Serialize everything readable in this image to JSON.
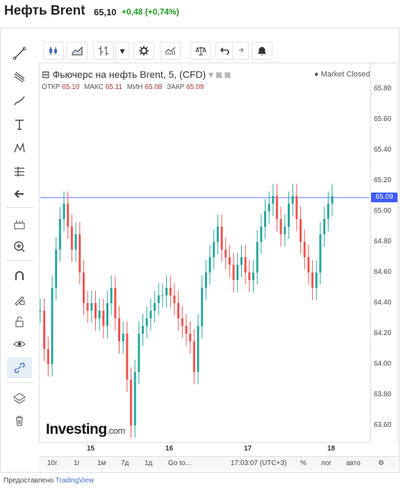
{
  "header": {
    "title": "Нефть Brent",
    "price": "65,10",
    "change": "+0,48 (+0,74%)"
  },
  "toolbar": {
    "more_label": "▾"
  },
  "legend": {
    "symbol": "Фьючерс на нефть Brent, 5, (CFD)",
    "market_status": "Market Closed",
    "ohlc": [
      {
        "k": "ОТКР",
        "v": "65.10"
      },
      {
        "k": "МАКС",
        "v": "65.11"
      },
      {
        "k": "МИН",
        "v": "65.08"
      },
      {
        "k": "ЗАКР",
        "v": "65.09"
      }
    ]
  },
  "brand": {
    "name": "Investing",
    "suffix": ".com"
  },
  "current_price_label": "65.09",
  "bottom_bar": {
    "ranges": [
      "10г",
      "1г",
      "1м",
      "7д",
      "1д"
    ],
    "goto": "Go to...",
    "time": "17:03:07 (UTC+3)",
    "pct": "%",
    "log": "лог",
    "auto": "авто"
  },
  "credit": {
    "prefix": "Предоставлено",
    "link": "TradingView"
  },
  "colors": {
    "up": "#26a69a",
    "down": "#ef5350",
    "price_line": "#3d5afe"
  },
  "chart_data": {
    "type": "line",
    "x": [
      "15",
      "16",
      "17",
      "18"
    ],
    "ylim": [
      63.5,
      65.9
    ],
    "yticks": [
      "65.80",
      "65.60",
      "65.40",
      "65.20",
      "65.00",
      "64.80",
      "64.60",
      "64.40",
      "64.20",
      "64.00",
      "63.80",
      "63.60"
    ],
    "series": [
      {
        "values": [
          64.35,
          64.1,
          64.0,
          64.5,
          64.75,
          64.95,
          65.05,
          64.9,
          64.75,
          64.85,
          64.6,
          64.4,
          64.35,
          64.4,
          64.3,
          64.35,
          64.25,
          64.4,
          64.5,
          64.3,
          64.15,
          64.2,
          63.9,
          63.6,
          63.95,
          64.2,
          64.25,
          64.3,
          64.35,
          64.4,
          64.45,
          64.45,
          64.5,
          64.45,
          64.4,
          64.3,
          64.25,
          64.2,
          64.15,
          63.95,
          64.25,
          64.5,
          64.6,
          64.7,
          64.8,
          64.9,
          64.75,
          64.7,
          64.65,
          64.55,
          64.65,
          64.7,
          64.6,
          64.55,
          64.6,
          64.8,
          64.9,
          65.0,
          65.05,
          65.1,
          64.95,
          64.85,
          64.9,
          65.05,
          65.1,
          64.95,
          64.8,
          64.7,
          64.6,
          64.5,
          64.6,
          64.85,
          64.95,
          65.05,
          65.1
        ]
      }
    ]
  }
}
